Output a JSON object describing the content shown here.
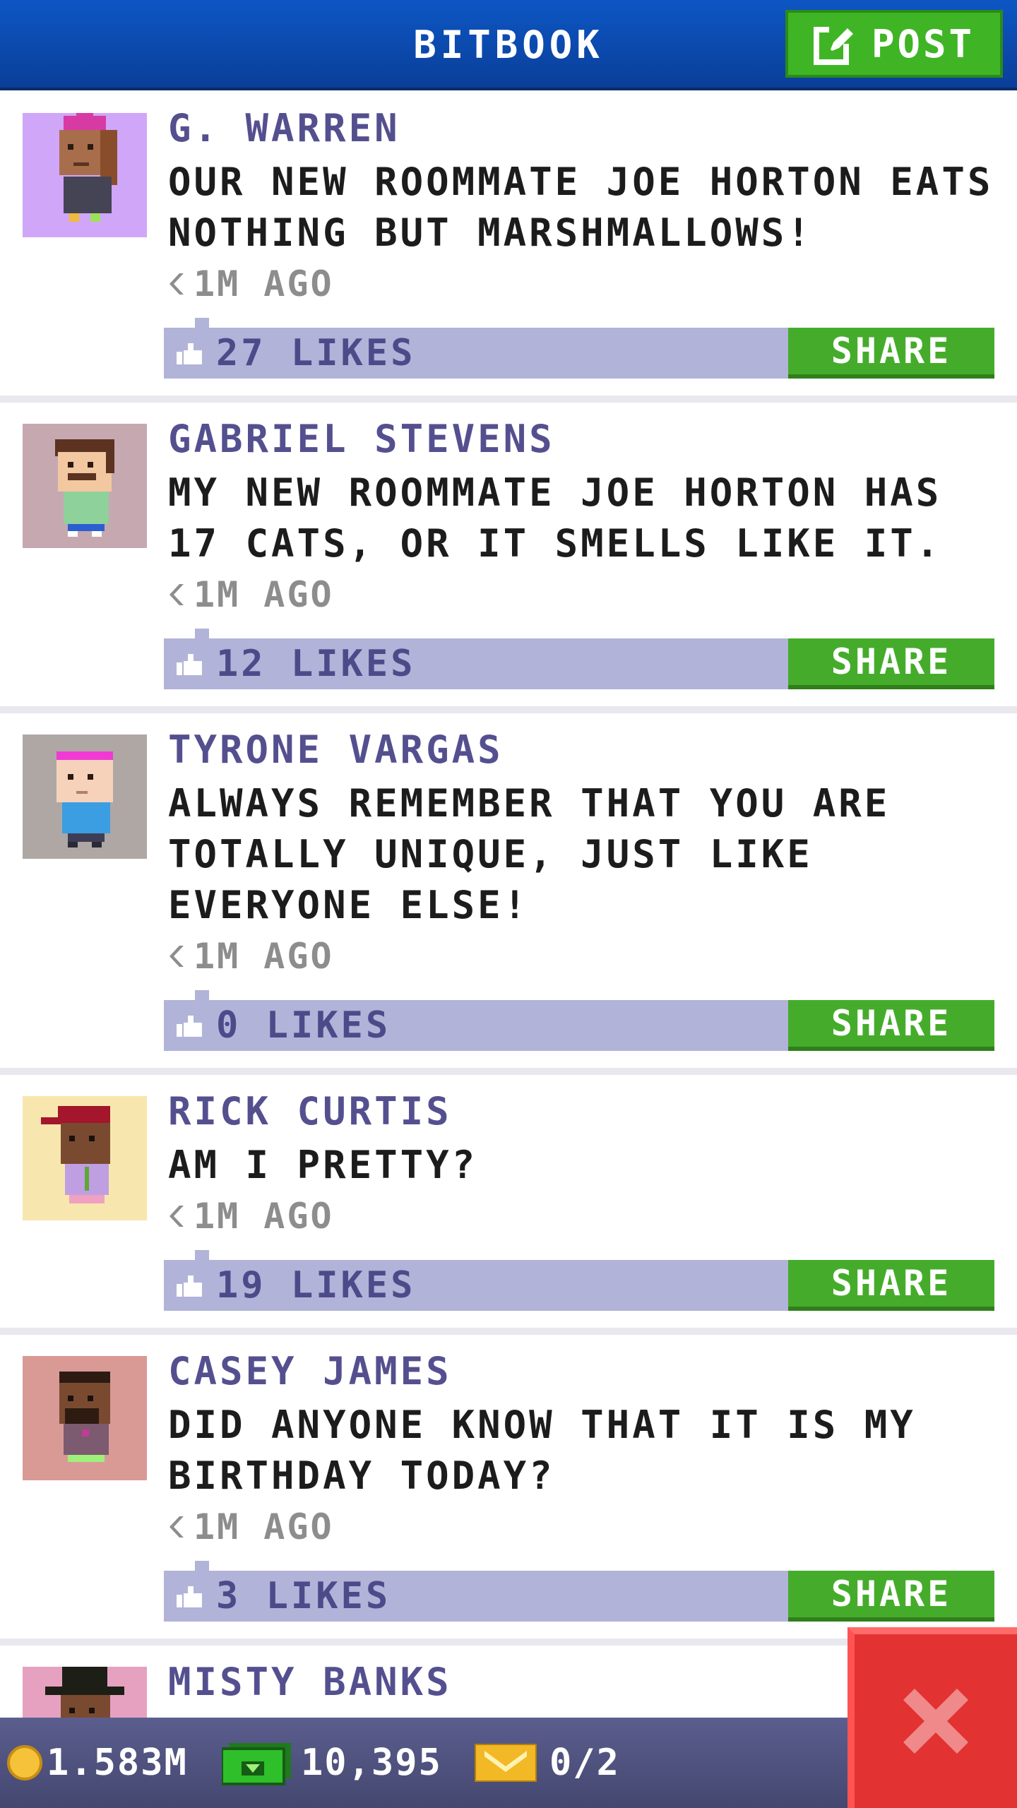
{
  "header": {
    "title": "BITBOOK",
    "post_label": "POST"
  },
  "feed": {
    "share_label": "SHARE",
    "posts": [
      {
        "author": "G. WARREN",
        "message": "OUR NEW ROOMMATE JOE HORTON EATS NOTHING BUT MARSHMALLOWS!",
        "time": "1M AGO",
        "likes": "27 LIKES",
        "avatar_bg": "#cfa6f8"
      },
      {
        "author": "GABRIEL STEVENS",
        "message": "MY NEW ROOMMATE JOE HORTON HAS 17 CATS, OR IT SMELLS LIKE IT.",
        "time": "1M AGO",
        "likes": "12 LIKES",
        "avatar_bg": "#c6a8b1"
      },
      {
        "author": "TYRONE VARGAS",
        "message": "ALWAYS REMEMBER THAT YOU ARE TOTALLY UNIQUE, JUST LIKE EVERYONE ELSE!",
        "time": "1M AGO",
        "likes": "0 LIKES",
        "avatar_bg": "#afa7a4"
      },
      {
        "author": "RICK CURTIS",
        "message": "AM I PRETTY?",
        "time": "1M AGO",
        "likes": "19 LIKES",
        "avatar_bg": "#f7e7ae"
      },
      {
        "author": "CASEY JAMES",
        "message": "DID ANYONE KNOW THAT IT IS MY BIRTHDAY TODAY?",
        "time": "1M AGO",
        "likes": "3 LIKES",
        "avatar_bg": "#d99a96"
      },
      {
        "author": "MISTY BANKS",
        "avatar_bg": "#e6a1c0"
      }
    ]
  },
  "status": {
    "coins": "1.583M",
    "bux": "10,395",
    "tickets": "0/2"
  },
  "colors": {
    "header_blue": "#0d56c4",
    "button_green": "#45ac2b",
    "likes_bar": "#b1b3d8",
    "author_purple": "#54508f",
    "close_red": "#e33232"
  },
  "icons": {
    "post": "edit-icon",
    "like": "thumbs-up-icon",
    "time": "clock-icon",
    "coins": "coin-icon",
    "bux": "cash-icon",
    "tickets": "ticket-icon",
    "close": "close-icon"
  }
}
